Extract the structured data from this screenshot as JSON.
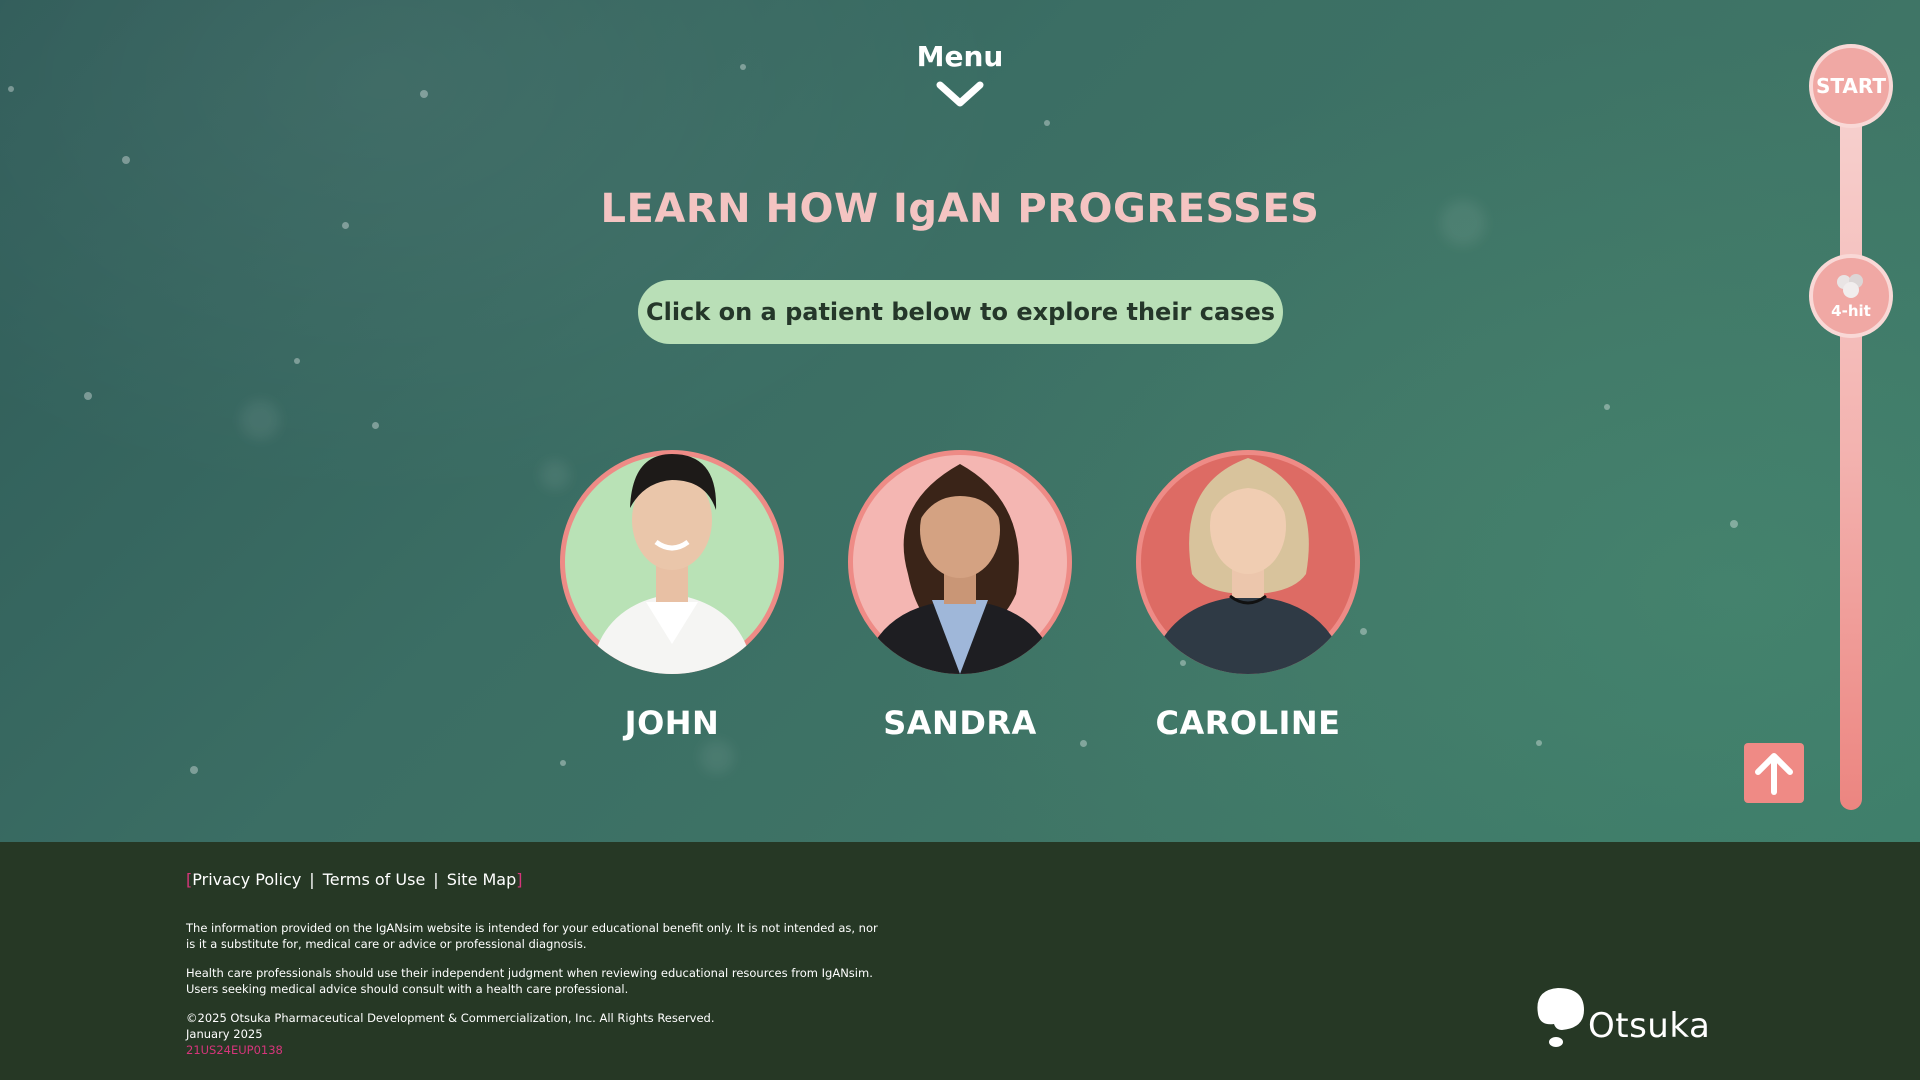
{
  "menu": {
    "label": "Menu"
  },
  "hero": {
    "title": "LEARN HOW IgAN PROGRESSES",
    "instruction": "Click on a patient below to explore their cases"
  },
  "patients": [
    {
      "name": "JOHN",
      "bg": "#b9e2b6"
    },
    {
      "name": "SANDRA",
      "bg": "#f4b6b2"
    },
    {
      "name": "CAROLINE",
      "bg": "#dd6b64"
    }
  ],
  "progress_rail": {
    "stops": [
      {
        "label": "START"
      },
      {
        "label": "4-hit",
        "icon": "molecule-icon"
      }
    ]
  },
  "footer": {
    "links": [
      "Privacy Policy",
      "Terms of Use",
      "Site Map"
    ],
    "disclaimer_1": "The information provided on the IgANsim website is intended for your educational benefit only. It is not intended as, nor is it a substitute for, medical care or advice or professional diagnosis.",
    "disclaimer_2": "Health care professionals should use their independent judgment when reviewing educational resources from IgANsim. Users seeking medical advice should consult with a health care professional.",
    "copyright": "©2025 Otsuka Pharmaceutical Development & Commercialization, Inc. All Rights Reserved.",
    "date": "January 2025",
    "code": "21US24EUP0138",
    "logo_text": "Otsuka"
  },
  "colors": {
    "accent_pink": "#f4c4c2",
    "pill_green": "#b9dfb7",
    "button_coral": "#ef8a85",
    "footer_bg": "#263825",
    "link_magenta": "#d6357b"
  }
}
